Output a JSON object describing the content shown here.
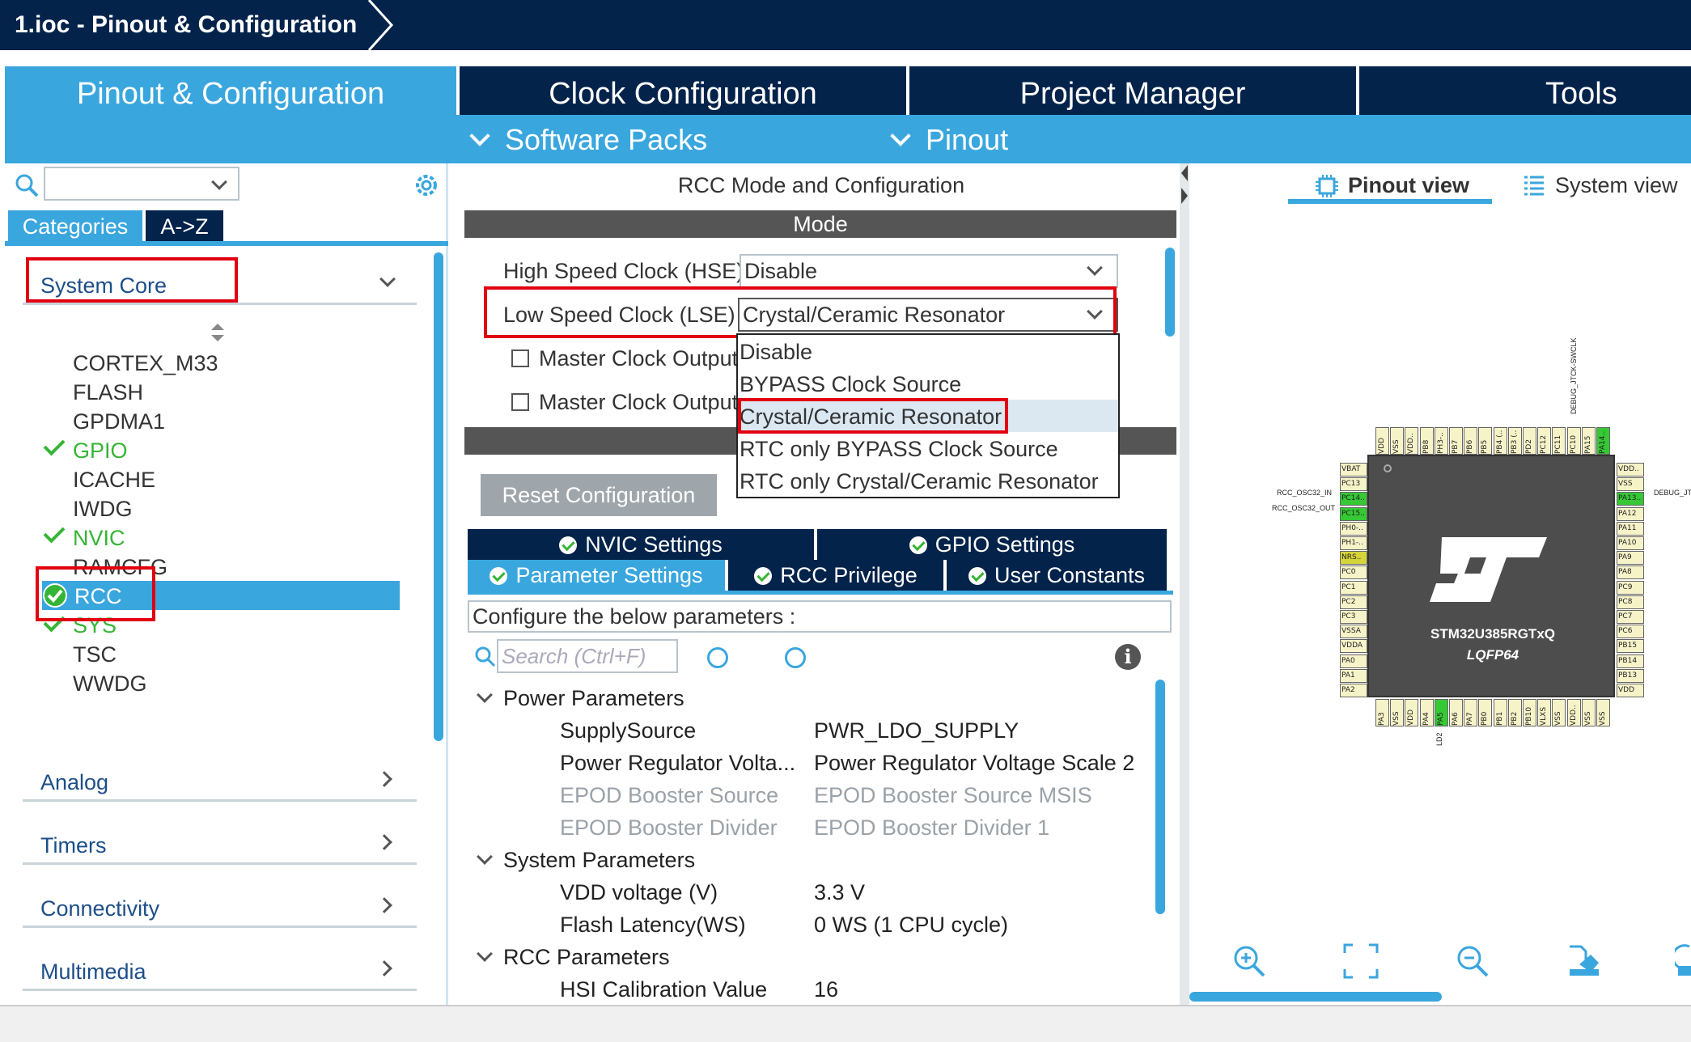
{
  "window": {
    "breadcrumb": "1.ioc - Pinout & Configuration"
  },
  "main_tabs": [
    {
      "label": "Pinout & Configuration"
    },
    {
      "label": "Clock Configuration"
    },
    {
      "label": "Project Manager"
    },
    {
      "label": "Tools"
    }
  ],
  "subbar": {
    "software_packs": "Software Packs",
    "pinout": "Pinout"
  },
  "left": {
    "cat_tabs": [
      "Categories",
      "A->Z"
    ],
    "system_core": "System Core",
    "items": [
      "CORTEX_M33",
      "FLASH",
      "GPDMA1",
      "GPIO",
      "ICACHE",
      "IWDG",
      "NVIC",
      "RAMCFG",
      "RCC",
      "SYS",
      "TSC",
      "WWDG"
    ],
    "groups": [
      "Analog",
      "Timers",
      "Connectivity",
      "Multimedia"
    ]
  },
  "middle": {
    "title": "RCC Mode and Configuration",
    "mode_bar": "Mode",
    "hse_label": "High Speed Clock (HSE)",
    "hse_value": "Disable",
    "lse_label": "Low Speed Clock (LSE)",
    "lse_value": "Crystal/Ceramic Resonator",
    "mco1": "Master Clock Output",
    "mco2": "Master Clock Output",
    "dropdown_options": [
      "Disable",
      "BYPASS Clock Source",
      "Crystal/Ceramic Resonator",
      "RTC only BYPASS Clock Source",
      "RTC only Crystal/Ceramic Resonator"
    ],
    "reset_button": "Reset Configuration",
    "settings_tabs_row1": [
      "NVIC Settings",
      "GPIO Settings"
    ],
    "settings_tabs_row2": [
      "Parameter Settings",
      "RCC Privilege",
      "User Constants"
    ],
    "configure_text": "Configure the below parameters :",
    "search_placeholder": "Search (Ctrl+F)",
    "params": {
      "power_group": "Power Parameters",
      "supply_source": {
        "name": "SupplySource",
        "value": "PWR_LDO_SUPPLY"
      },
      "regulator": {
        "name": "Power Regulator Volta...",
        "value": "Power Regulator Voltage Scale 2"
      },
      "epod_source": {
        "name": "EPOD Booster Source",
        "value": "EPOD Booster Source MSIS"
      },
      "epod_divider": {
        "name": "EPOD Booster Divider",
        "value": "EPOD Booster Divider 1"
      },
      "system_group": "System Parameters",
      "vdd": {
        "name": "VDD voltage (V)",
        "value": "3.3 V"
      },
      "flash_latency": {
        "name": "Flash Latency(WS)",
        "value": "0 WS (1 CPU cycle)"
      },
      "rcc_group": "RCC Parameters",
      "hsi_cal": {
        "name": "HSI Calibration Value",
        "value": "16"
      }
    }
  },
  "right": {
    "pinout_view": "Pinout view",
    "system_view": "System view",
    "chip_name": "STM32U385RGTxQ",
    "package": "LQFP64",
    "left_pin_labels": [
      "RCC_OSC32_IN",
      "RCC_OSC32_OUT"
    ],
    "right_pin_label": "DEBUG_JT",
    "top_pin_label": "DEBUG_JTCK-SWCLK",
    "bottom_pin_label": "LD2",
    "left_pins": [
      "VBAT",
      "PC13",
      "PC14..",
      "PC15..",
      "PH0-..",
      "PH1-..",
      "NRS..",
      "PC0",
      "PC1",
      "PC2",
      "PC3",
      "VSSA",
      "VDDA",
      "PA0",
      "PA1",
      "PA2"
    ],
    "right_pins": [
      "VDD..",
      "VSS",
      "PA13..",
      "PA12",
      "PA11",
      "PA10",
      "PA9",
      "PA8",
      "PC9",
      "PC8",
      "PC7",
      "PC6",
      "PB15",
      "PB14",
      "PB13",
      "VDD"
    ],
    "top_pins": [
      "VDD",
      "VSS",
      "VDD..",
      "PB8",
      "PH3-..",
      "PB7",
      "PB6",
      "PB5",
      "PB4 (..",
      "PB3 (..",
      "PD2",
      "PC12",
      "PC11",
      "PC10",
      "PA15",
      "PA14.."
    ],
    "bottom_pins": [
      "PA3",
      "VSS",
      "VDD",
      "PA4",
      "PA5",
      "PA6",
      "PA7",
      "PB0",
      "PB1",
      "PB2",
      "PB10",
      "VLXS",
      "VSS",
      "VDD..",
      "VSS",
      "VSS"
    ]
  },
  "colors": {
    "navy": "#03234b",
    "accent": "#3aa6de",
    "green_pin": "#35c935",
    "yellow_pin": "#d5d53a",
    "pin_bg": "#f7f3c8",
    "highlight_red": "#e2000f"
  }
}
